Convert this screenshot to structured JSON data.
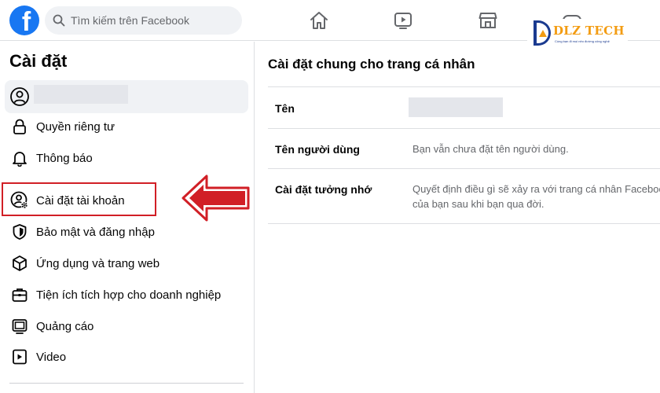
{
  "search": {
    "placeholder": "Tìm kiếm trên Facebook"
  },
  "nav": {
    "icons": [
      "home-icon",
      "watch-icon",
      "marketplace-icon",
      "gaming-icon"
    ]
  },
  "watermark": {
    "name": "DLZ TECH",
    "tagline": "Cùng bạn đi mọi nẻo đường công nghệ"
  },
  "sidebar": {
    "title": "Cài đặt",
    "items": [
      {
        "label": "Quyền riêng tư",
        "icon": "lock-icon"
      },
      {
        "label": "Thông báo",
        "icon": "bell-icon"
      },
      {
        "label": "Cài đặt tài khoản",
        "icon": "account-settings-icon",
        "highlighted": true
      },
      {
        "label": "Bảo mật và đăng nhập",
        "icon": "shield-icon"
      },
      {
        "label": "Ứng dụng và trang web",
        "icon": "cube-icon"
      },
      {
        "label": "Tiện ích tích hợp cho doanh nghiệp",
        "icon": "briefcase-icon"
      },
      {
        "label": "Quảng cáo",
        "icon": "ad-icon"
      },
      {
        "label": "Video",
        "icon": "video-icon"
      }
    ]
  },
  "main": {
    "title": "Cài đặt chung cho trang cá nhân",
    "rows": [
      {
        "label": "Tên",
        "value": ""
      },
      {
        "label": "Tên người dùng",
        "value": "Bạn vẫn chưa đặt tên người dùng."
      },
      {
        "label": "Cài đặt tưởng nhớ",
        "value": "Quyết định điều gì sẽ xảy ra với trang cá nhân Facebook của bạn sau khi bạn qua đời."
      }
    ]
  },
  "colors": {
    "brand": "#1877f2",
    "highlight": "#d11f26",
    "watermark_orange": "#f39c12",
    "watermark_blue": "#1a3a8f"
  }
}
